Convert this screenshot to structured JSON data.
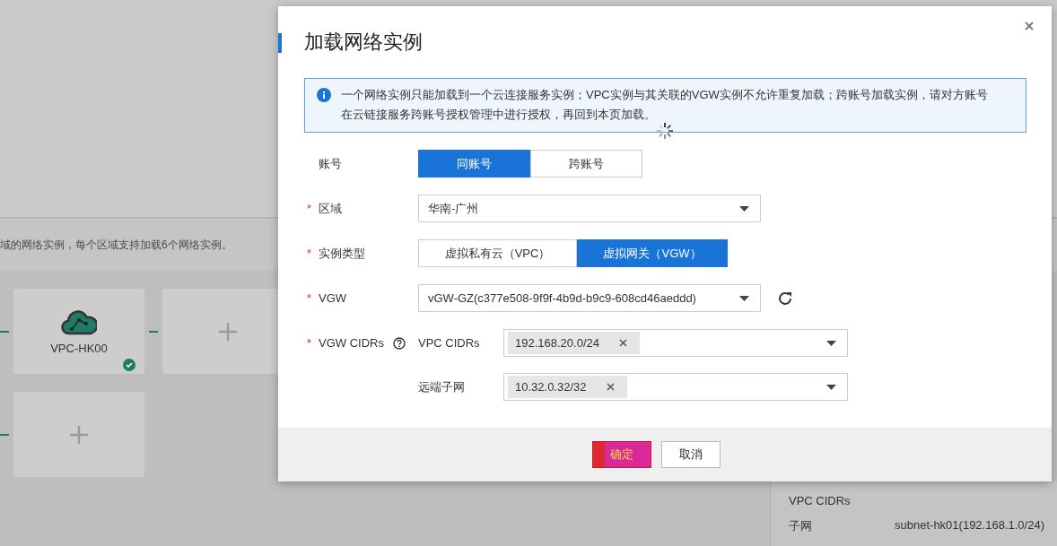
{
  "background": {
    "notice": "域的网络实例，每个区域支持加载6个网络实例。",
    "instance_rows": [
      {
        "cards": [
          {
            "kind": "instance",
            "name": "VPC-HK00",
            "connected": true
          },
          {
            "kind": "add"
          }
        ]
      },
      {
        "cards": [
          {
            "kind": "add"
          }
        ]
      }
    ],
    "detail": [
      {
        "label": "VPC CIDRs"
      },
      {
        "label": "子网",
        "value": "subnet-hk01(192.168.1.0/24)"
      }
    ]
  },
  "dialog": {
    "title": "加载网络实例",
    "notice": "一个网络实例只能加载到一个云连接服务实例；VPC实例与其关联的VGW实例不允许重复加载；跨账号加载实例，请对方账号在云链接服务跨账号授权管理中进行授权，再回到本页加载。",
    "fields": [
      {
        "kind": "segmented",
        "label": "账号",
        "options": [
          {
            "label": "同账号",
            "selected": true
          },
          {
            "label": "跨账号",
            "selected": false
          }
        ]
      },
      {
        "kind": "select",
        "label": "区域",
        "required_mark": "*",
        "value": "华南-广州"
      },
      {
        "kind": "segmented",
        "label": "实例类型",
        "required_mark": "*",
        "options": [
          {
            "label": "虚拟私有云（VPC）",
            "selected": false
          },
          {
            "label": "虚拟网关（VGW）",
            "selected": true
          }
        ]
      },
      {
        "kind": "select",
        "label": "VGW",
        "required_mark": "*",
        "value": "vGW-GZ(c377e508-9f9f-4b9d-b9c9-608cd46aeddd)",
        "refresh": true
      },
      {
        "kind": "cidrs",
        "label": "VGW CIDRs",
        "required_mark": "*",
        "help": true,
        "subfields": [
          {
            "label": "VPC CIDRs",
            "tags": [
              "192.168.20.0/24"
            ]
          },
          {
            "label": "远端子网",
            "tags": [
              "10.32.0.32/32"
            ]
          }
        ]
      }
    ],
    "buttons": [
      {
        "kind": "primary",
        "label": "确定"
      },
      {
        "kind": "secondary",
        "label": "取消"
      }
    ]
  }
}
